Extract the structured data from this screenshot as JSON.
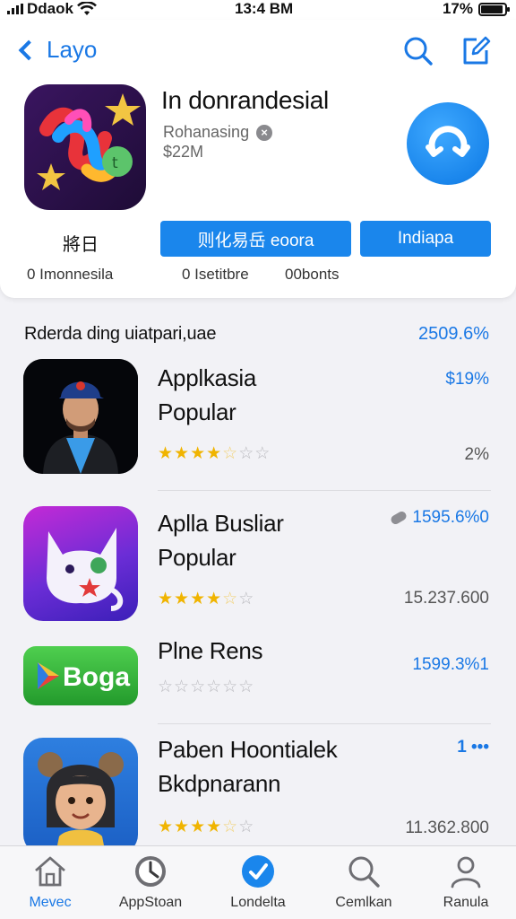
{
  "status": {
    "carrier": "Ddaok",
    "time": "13:4 BM",
    "battery": "17%"
  },
  "nav": {
    "back_label": "Layo"
  },
  "hero": {
    "title": "In donrandesial",
    "developer": "Rohanasing",
    "size": "$22M",
    "category": "將日",
    "primary_button": "则化易岳 eoora",
    "secondary_button": "Indiapa",
    "meta": [
      "0 Imonnesila",
      "0 Isetitbre",
      "00bonts"
    ]
  },
  "section": {
    "title": "Rderda ding uiatpari,uae",
    "stat": "2509.6%"
  },
  "apps": [
    {
      "name_line1": "Applkasia",
      "name_line2": "Popular",
      "stat": "$19%",
      "sub": "2%",
      "rating": 3.5
    },
    {
      "name_line1": "Aplla Busliar",
      "name_line2": "Popular",
      "stat": "1595.6%0",
      "sub": "15.237.600",
      "rating": 3.5
    },
    {
      "name_line1": "Plne Rens",
      "name_line2": "",
      "stat": "1599.3%1",
      "sub": "",
      "rating": 0,
      "icon_text": "Boga"
    },
    {
      "name_line1": "Paben Hoontialek",
      "name_line2": "Bkdpnarann",
      "stat": "1 •••",
      "sub": "11.362.800",
      "rating": 3.5
    }
  ],
  "tabs": [
    "Mevec",
    "AppStoan",
    "Londelta",
    "Cemlkan",
    "Ranula"
  ],
  "colors": {
    "accent": "#1a86ec",
    "star": "#f0b400"
  }
}
